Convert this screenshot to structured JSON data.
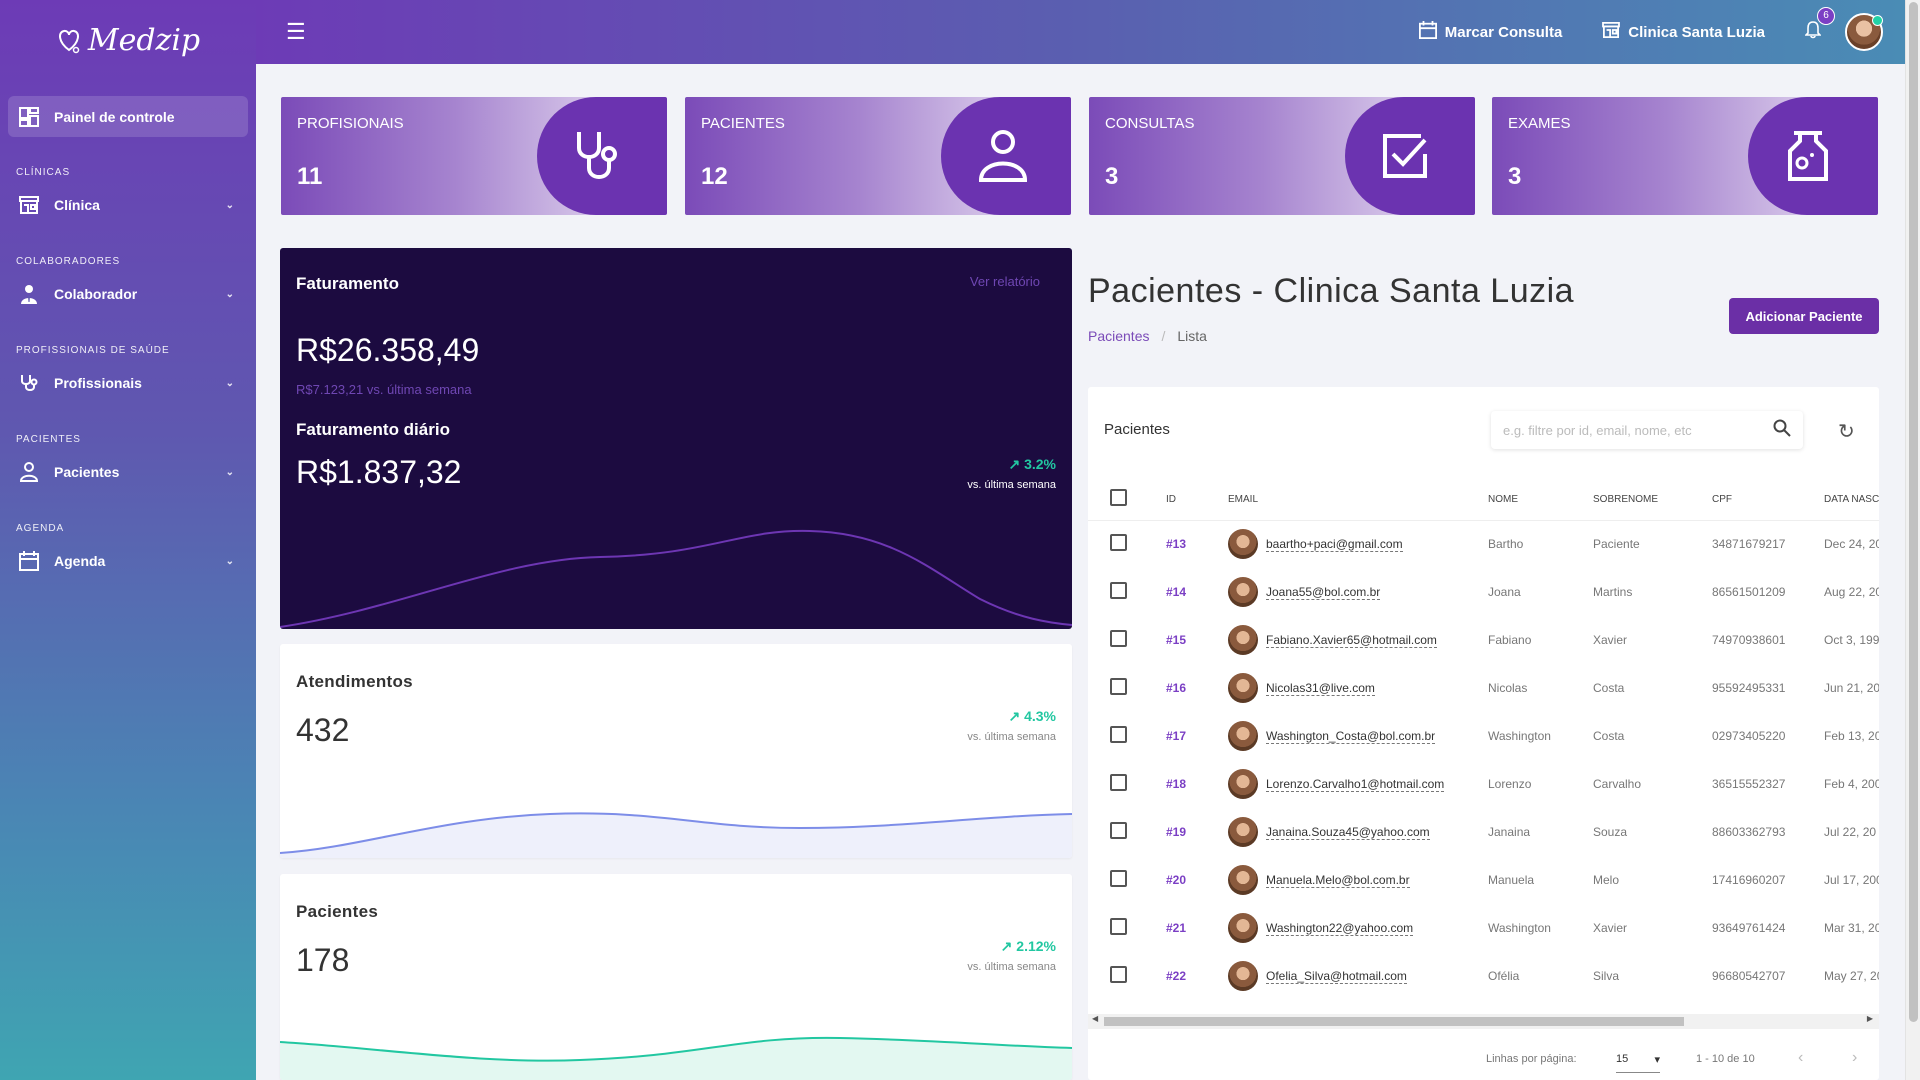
{
  "brand": {
    "name": "Medzip"
  },
  "sidebar": {
    "active": "Painel de controle",
    "sections": [
      {
        "title": "CLÍNICAS",
        "item": "Clínica",
        "icon": "store-icon"
      },
      {
        "title": "COLABORADORES",
        "item": "Colaborador",
        "icon": "user-tie-icon"
      },
      {
        "title": "PROFISSIONAIS DE SAÚDE",
        "item": "Profissionais",
        "icon": "stethoscope-icon"
      },
      {
        "title": "PACIENTES",
        "item": "Pacientes",
        "icon": "person-icon"
      },
      {
        "title": "AGENDA",
        "item": "Agenda",
        "icon": "calendar-icon"
      }
    ]
  },
  "topbar": {
    "schedule": "Marcar Consulta",
    "clinic": "Clinica Santa Luzia",
    "notifications": "6"
  },
  "stats": [
    {
      "label": "PROFISIONAIS",
      "value": "11",
      "icon": "stethoscope-icon"
    },
    {
      "label": "PACIENTES",
      "value": "12",
      "icon": "person-icon"
    },
    {
      "label": "CONSULTAS",
      "value": "3",
      "icon": "checkbox-icon"
    },
    {
      "label": "EXAMES",
      "value": "3",
      "icon": "flask-icon"
    }
  ],
  "revenue": {
    "title": "Faturamento",
    "link": "Ver relatório",
    "total": "R$26.358,49",
    "sub": "R$7.123,21 vs. última semana",
    "daily_title": "Faturamento diário",
    "daily": "R$1.837,32",
    "pct": "3.2%",
    "vs": "vs. última semana"
  },
  "atendimentos": {
    "title": "Atendimentos",
    "value": "432",
    "pct": "4.3%",
    "vs": "vs. última semana"
  },
  "pacientes_card": {
    "title": "Pacientes",
    "value": "178",
    "pct": "2.12%",
    "vs": "vs. última semana"
  },
  "colors": {
    "accent": "#6b2fa6",
    "green": "#22c7a1",
    "dark": "#1c0b40"
  },
  "page": {
    "title": "Pacientes - Clinica Santa Luzia",
    "crumb1": "Pacientes",
    "crumb_sep": "/",
    "crumb2": "Lista",
    "add": "Adicionar Paciente"
  },
  "table": {
    "title": "Pacientes",
    "search_placeholder": "e.g. filtre por id, email, nome, etc",
    "headers": [
      "ID",
      "EMAIL",
      "NOME",
      "SOBRENOME",
      "CPF",
      "DATA NASC"
    ],
    "rows": [
      [
        "#13",
        "baartho+paci@gmail.com",
        "Bartho",
        "Paciente",
        "34871679217",
        "Dec 24, 20"
      ],
      [
        "#14",
        "Joana55@bol.com.br",
        "Joana",
        "Martins",
        "86561501209",
        "Aug 22, 20"
      ],
      [
        "#15",
        "Fabiano.Xavier65@hotmail.com",
        "Fabiano",
        "Xavier",
        "74970938601",
        "Oct 3, 199"
      ],
      [
        "#16",
        "Nicolas31@live.com",
        "Nicolas",
        "Costa",
        "95592495331",
        "Jun 21, 20"
      ],
      [
        "#17",
        "Washington_Costa@bol.com.br",
        "Washington",
        "Costa",
        "02973405220",
        "Feb 13, 20"
      ],
      [
        "#18",
        "Lorenzo.Carvalho1@hotmail.com",
        "Lorenzo",
        "Carvalho",
        "36515552327",
        "Feb 4, 200"
      ],
      [
        "#19",
        "Janaina.Souza45@yahoo.com",
        "Janaina",
        "Souza",
        "88603362793",
        "Jul 22, 20"
      ],
      [
        "#20",
        "Manuela.Melo@bol.com.br",
        "Manuela",
        "Melo",
        "17416960207",
        "Jul 17, 200"
      ],
      [
        "#21",
        "Washington22@yahoo.com",
        "Washington",
        "Xavier",
        "93649761424",
        "Mar 31, 20"
      ],
      [
        "#22",
        "Ofelia_Silva@hotmail.com",
        "Ofélia",
        "Silva",
        "96680542707",
        "May 27, 20"
      ]
    ],
    "rows_label": "Linhas por página:",
    "rows_value": "15",
    "range": "1 - 10 de 10"
  }
}
